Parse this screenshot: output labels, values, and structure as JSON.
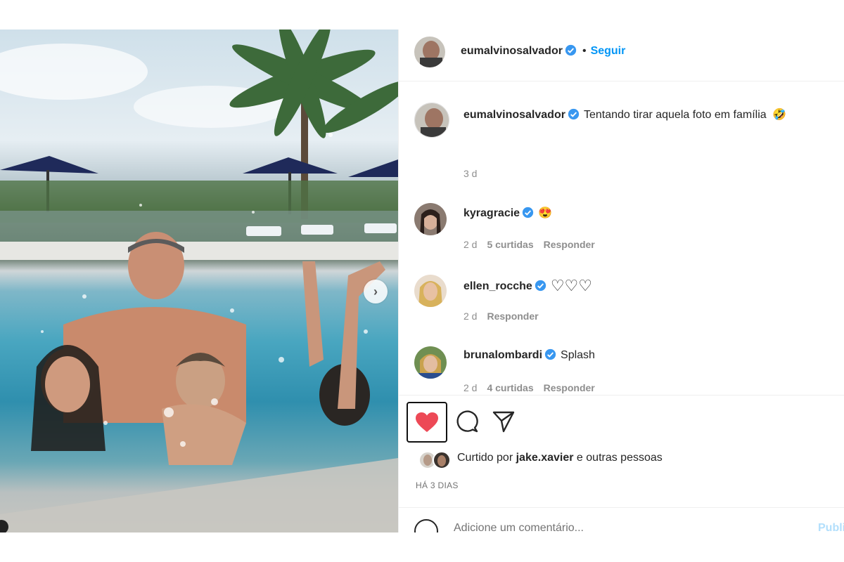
{
  "post": {
    "author": "eumalvinosalvador",
    "follow_label": "Seguir",
    "caption": "Tentando tirar aquela foto em família",
    "caption_emoji": "🤣",
    "caption_time": "3 d"
  },
  "comments": [
    {
      "user": "kyragracie",
      "text": "😍",
      "time": "2 d",
      "likes": "5 curtidas",
      "reply": "Responder"
    },
    {
      "user": "ellen_rocche",
      "text": "♡♡♡",
      "time": "2 d",
      "reply": "Responder"
    },
    {
      "user": "brunalombardi",
      "text": "Splash",
      "time": "2 d",
      "likes": "4 curtidas",
      "reply": "Responder"
    }
  ],
  "likes": {
    "prefix": "Curtido por",
    "user": "jake.xavier",
    "suffix": "e outras pessoas"
  },
  "time_ago": "HÁ 3 DIAS",
  "add_comment": {
    "placeholder": "Adicione um comentário...",
    "publish_label": "Publicar"
  },
  "colors": {
    "accent": "#0095f6",
    "like": "#ed4956",
    "verified": "#3897f0"
  },
  "icons": [
    "heart-filled-icon",
    "comment-icon",
    "share-icon",
    "chevron-right-icon",
    "verified-icon",
    "emoji-icon"
  ]
}
